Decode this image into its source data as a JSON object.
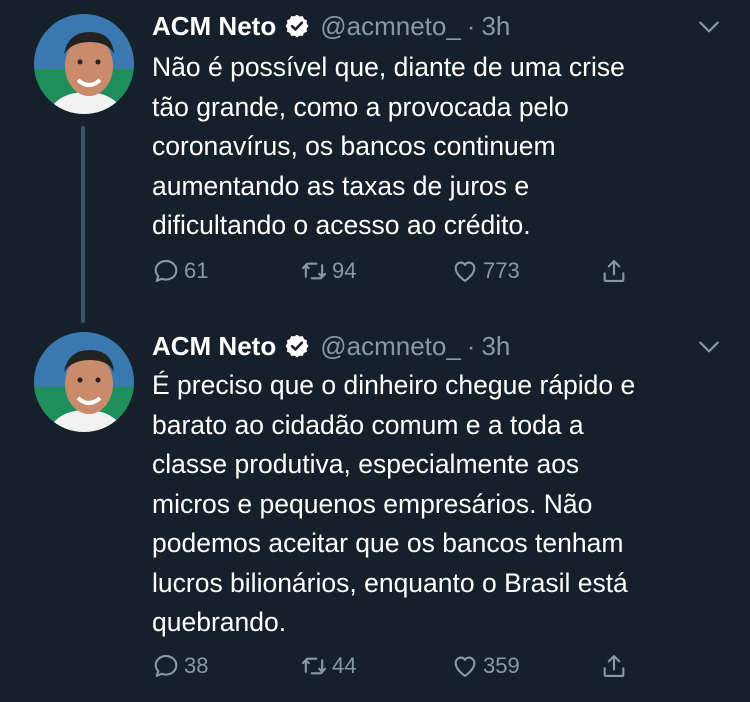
{
  "thread": [
    {
      "author": {
        "name": "ACM Neto",
        "handle": "@acmneto_",
        "verified": true
      },
      "separator": "·",
      "time": "3h",
      "text": "Não é possível que, diante de uma crise\ntão grande, como a provocada pelo\ncoronavírus, os bancos continuem\naumentando as taxas de juros e\ndificultando o acesso ao crédito.",
      "replies": "61",
      "retweets": "94",
      "likes": "773"
    },
    {
      "author": {
        "name": "ACM Neto",
        "handle": "@acmneto_",
        "verified": true
      },
      "separator": "·",
      "time": "3h",
      "text": "É preciso que o dinheiro chegue rápido e\nbarato ao cidadão comum e a toda a\nclasse produtiva, especialmente aos\nmicros e pequenos empresários. Não\npodemos aceitar que os bancos tenham\nlucros bilionários, enquanto o Brasil está\nquebrando.",
      "replies": "38",
      "retweets": "44",
      "likes": "359"
    }
  ],
  "icons": {
    "verified": "verified-badge-icon",
    "more": "chevron-down-icon",
    "reply": "reply-icon",
    "retweet": "retweet-icon",
    "like": "heart-icon",
    "share": "share-icon"
  },
  "colors": {
    "background": "#15202b",
    "text": "#ffffff",
    "secondary": "#8899a6",
    "thread_line": "#3d5466"
  }
}
